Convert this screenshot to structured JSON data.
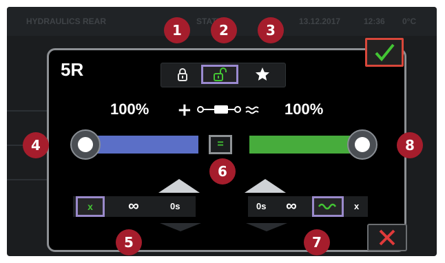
{
  "topbar": {
    "title": "HYDRAULICS REAR",
    "middle": "STATUS",
    "date": "13.12.2017",
    "time": "12:36",
    "temp": "0°C"
  },
  "panel": {
    "title": "5R",
    "modes": [
      "lock-icon",
      "unlock-icon",
      "star-icon"
    ],
    "selected_mode": "unlock-icon"
  },
  "left": {
    "percent": "100%",
    "slider_color": "#5b6fc7",
    "level": 1.0,
    "x_label": "x",
    "infinity": "∞",
    "time": "0s"
  },
  "center": {
    "equal_label": "="
  },
  "right": {
    "percent": "100%",
    "slider_color": "#47ac3c",
    "level": 1.0,
    "time": "0s",
    "infinity": "∞",
    "x_label": "x"
  },
  "badges": [
    "1",
    "2",
    "3",
    "4",
    "5",
    "6",
    "7",
    "8"
  ],
  "colors": {
    "badge": "#a51d2c",
    "selection": "#9b8ad0",
    "confirm_border": "#d9473a",
    "check": "#43c534",
    "cancel_x": "#e03a3a"
  }
}
